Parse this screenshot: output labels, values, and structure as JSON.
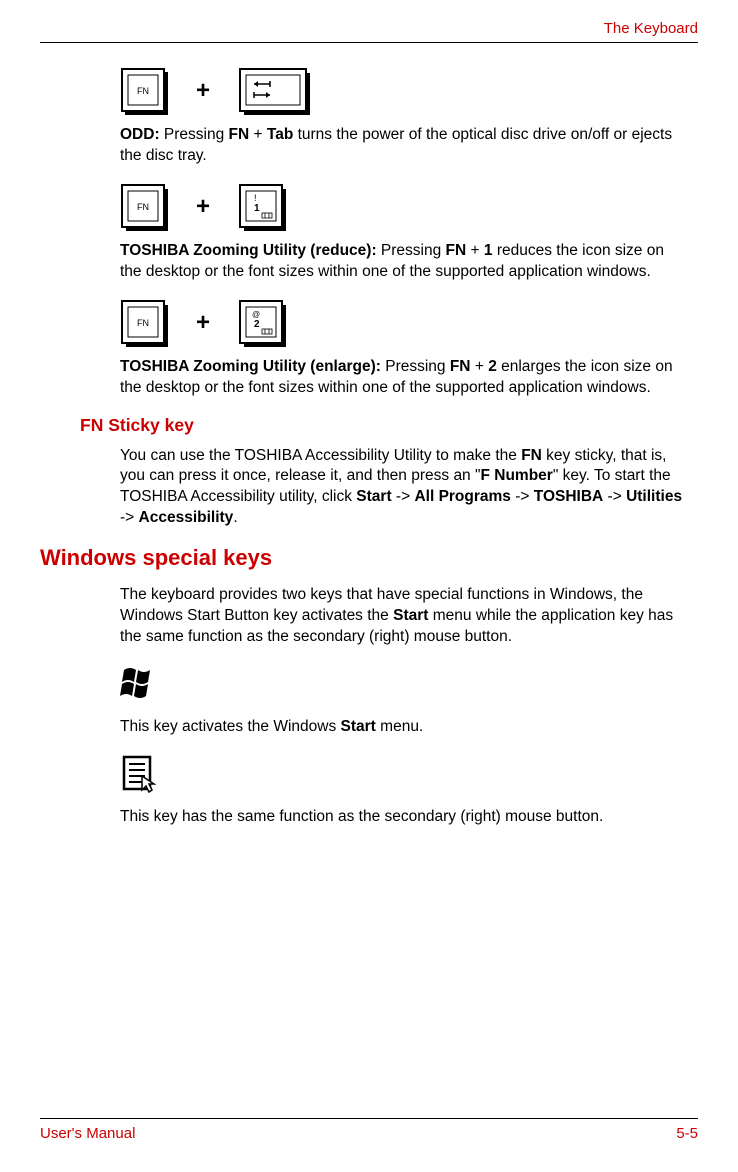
{
  "header": {
    "title": "The Keyboard"
  },
  "items": {
    "odd": {
      "label": "ODD:",
      "text_before": " Pressing ",
      "key1": "FN",
      "plus": " + ",
      "key2": "Tab",
      "text_after": " turns the power of the optical disc drive on/off or ejects the disc tray."
    },
    "zoom_reduce": {
      "label": "TOSHIBA Zooming Utility (reduce):",
      "text_before": " Pressing ",
      "key1": "FN",
      "plus": " + ",
      "key2": "1",
      "text_after": " reduces the icon size on the desktop or the font sizes within one of the supported application windows."
    },
    "zoom_enlarge": {
      "label": "TOSHIBA Zooming Utility (enlarge):",
      "text_before": " Pressing ",
      "key1": "FN",
      "plus": " + ",
      "key2": "2",
      "text_after": " enlarges the icon size on the desktop or the font sizes within one of the supported application windows."
    }
  },
  "fn_sticky": {
    "title": "FN Sticky key",
    "p1_a": "You can use the TOSHIBA Accessibility Utility to make the ",
    "p1_b": "FN",
    "p1_c": " key sticky, that is, you can press it once, release it, and then press an \"",
    "p1_d": "F Number",
    "p1_e": "\" key. To start the TOSHIBA Accessibility utility, click ",
    "p1_f": "Start",
    "p1_g": " -> ",
    "p1_h": "All Programs",
    "p1_i": " -> ",
    "p1_j": "TOSHIBA",
    "p1_k": " -> ",
    "p1_l": "Utilities",
    "p1_m": " -> ",
    "p1_n": "Accessibility",
    "p1_o": "."
  },
  "windows_keys": {
    "title": "Windows special keys",
    "intro_a": "The keyboard provides two keys that have special functions in Windows, the Windows Start Button key activates the ",
    "intro_b": "Start",
    "intro_c": " menu while the application key has the same function as the secondary (right) mouse button.",
    "start_a": "This key activates the Windows ",
    "start_b": "Start",
    "start_c": " menu.",
    "app_key": "This key has the same function as the secondary (right) mouse button."
  },
  "footer": {
    "left": "User's Manual",
    "right": "5-5"
  },
  "glyphs": {
    "fn_label": "FN",
    "key1_label": "1",
    "key2_label": "2"
  }
}
